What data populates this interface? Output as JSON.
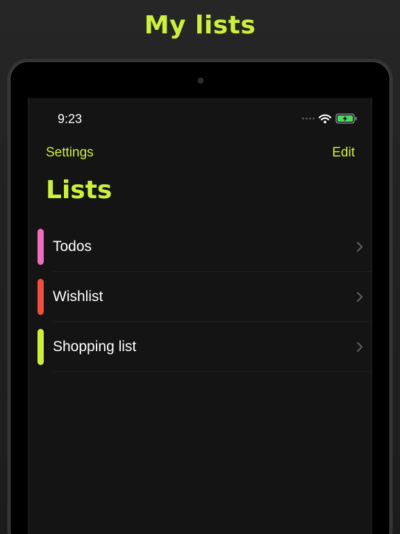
{
  "headline": "My lists",
  "status_bar": {
    "time": "9:23",
    "icons": [
      "signal-dots-icon",
      "wifi-icon",
      "battery-charging-icon"
    ]
  },
  "nav": {
    "left_label": "Settings",
    "right_label": "Edit"
  },
  "page_title": "Lists",
  "lists": [
    {
      "label": "Todos",
      "color": "#f06dbd",
      "icon": "chevron-right-icon"
    },
    {
      "label": "Wishlist",
      "color": "#ef4f3c",
      "icon": "chevron-right-icon"
    },
    {
      "label": "Shopping list",
      "color": "#cdf03e",
      "icon": "chevron-right-icon"
    }
  ],
  "colors": {
    "accent": "#cdf03e",
    "background": "#141414",
    "battery": "#4cd964"
  }
}
